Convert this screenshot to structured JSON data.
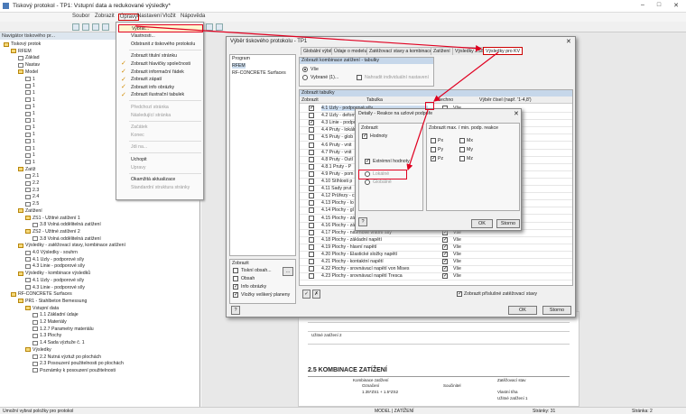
{
  "window": {
    "title": "Tiskový protokol - TP1: Vstupní data a redukované výsledky*"
  },
  "menu": [
    "Soubor",
    "Zobrazit",
    "Úpravy",
    "Nastavení",
    "Vložit",
    "Nápověda"
  ],
  "navigator": {
    "title": "Navigátor tiskového pr...",
    "items": [
      {
        "t": "Tiskový protok",
        "i": 0,
        "k": "f"
      },
      {
        "t": "RFEM",
        "i": 1,
        "k": "f"
      },
      {
        "t": "Základ",
        "i": 2,
        "k": "d"
      },
      {
        "t": "Nastav",
        "i": 2,
        "k": "d"
      },
      {
        "t": "Model",
        "i": 2,
        "k": "f"
      },
      {
        "t": "1",
        "i": 3,
        "k": "d"
      },
      {
        "t": "1",
        "i": 3,
        "k": "d"
      },
      {
        "t": "1",
        "i": 3,
        "k": "d"
      },
      {
        "t": "1",
        "i": 3,
        "k": "d"
      },
      {
        "t": "1",
        "i": 3,
        "k": "d"
      },
      {
        "t": "1",
        "i": 3,
        "k": "d"
      },
      {
        "t": "1",
        "i": 3,
        "k": "d"
      },
      {
        "t": "1",
        "i": 3,
        "k": "d"
      },
      {
        "t": "1",
        "i": 3,
        "k": "d"
      },
      {
        "t": "1",
        "i": 3,
        "k": "d"
      },
      {
        "t": "1",
        "i": 3,
        "k": "d"
      },
      {
        "t": "1",
        "i": 3,
        "k": "d"
      },
      {
        "t": "1",
        "i": 3,
        "k": "d"
      },
      {
        "t": "Zatíž",
        "i": 2,
        "k": "f"
      },
      {
        "t": "2.1",
        "i": 3,
        "k": "d"
      },
      {
        "t": "2.2",
        "i": 3,
        "k": "d"
      },
      {
        "t": "2.3",
        "i": 3,
        "k": "d"
      },
      {
        "t": "2.4",
        "i": 3,
        "k": "d"
      },
      {
        "t": "2.5",
        "i": 3,
        "k": "d"
      },
      {
        "t": "Zatížení",
        "i": 2,
        "k": "f"
      },
      {
        "t": "ZS1 - Užitné zatížení 1",
        "i": 3,
        "k": "f"
      },
      {
        "t": "3.8 Volná oddělitelná zatížení",
        "i": 4,
        "k": "d"
      },
      {
        "t": "ZS2 - Užitné zatížení 2",
        "i": 3,
        "k": "f"
      },
      {
        "t": "3.8 Volná oddělitelná zatížení",
        "i": 4,
        "k": "d"
      },
      {
        "t": "Výsledky - zatěžovací stavy, kombinace zatížení",
        "i": 2,
        "k": "f"
      },
      {
        "t": "4.0 Výsledky - souhrn",
        "i": 3,
        "k": "d"
      },
      {
        "t": "4.1 Uzly - podporové síly",
        "i": 3,
        "k": "d"
      },
      {
        "t": "4.3 Linie - podporové síly",
        "i": 3,
        "k": "d"
      },
      {
        "t": "Výsledky - kombinace výsledků",
        "i": 2,
        "k": "f"
      },
      {
        "t": "4.1 Uzly - podporové síly",
        "i": 3,
        "k": "d"
      },
      {
        "t": "4.3 Linie - podporové síly",
        "i": 3,
        "k": "d"
      },
      {
        "t": "RF-CONCRETE Surfaces",
        "i": 1,
        "k": "f"
      },
      {
        "t": "PR1 - Stahlbeton Bemessung",
        "i": 2,
        "k": "f"
      },
      {
        "t": "Vstupní data",
        "i": 3,
        "k": "f"
      },
      {
        "t": "1.1 Základní údaje",
        "i": 4,
        "k": "d"
      },
      {
        "t": "1.2 Materiály",
        "i": 4,
        "k": "d"
      },
      {
        "t": "1.2.7 Parametry materiálu",
        "i": 4,
        "k": "d"
      },
      {
        "t": "1.3 Plochy",
        "i": 4,
        "k": "d"
      },
      {
        "t": "1.4 Sada výztuže č. 1",
        "i": 4,
        "k": "d"
      },
      {
        "t": "Výsledky",
        "i": 3,
        "k": "f"
      },
      {
        "t": "2.2 Nutná výztuž po plochách",
        "i": 4,
        "k": "d"
      },
      {
        "t": "2.3 Posouzení použitelnosti po plochách",
        "i": 4,
        "k": "d"
      },
      {
        "t": "Poznámky k posouzení použitelnosti",
        "i": 4,
        "k": "d"
      }
    ]
  },
  "dropdown": [
    {
      "t": "Vybrat...",
      "hl": true
    },
    {
      "t": "Vlastnosti..."
    },
    {
      "t": "Odstranit z tiskového protokolu"
    },
    {
      "sep": true
    },
    {
      "t": "Zobrazit titulní stránku"
    },
    {
      "t": "Zobrazit hlavičky společnosti",
      "c": true
    },
    {
      "t": "Zobrazit informační řádek",
      "c": true
    },
    {
      "t": "Zobrazit zápatí",
      "c": true
    },
    {
      "t": "Zobrazit info obrázky",
      "c": true
    },
    {
      "t": "Zobrazit ilustrační tabulek",
      "c": true
    },
    {
      "sep": true
    },
    {
      "t": "Předchozí stránka",
      "d": true
    },
    {
      "t": "Následující stránka",
      "d": true
    },
    {
      "sep": true
    },
    {
      "t": "Začátek",
      "d": true
    },
    {
      "t": "Konec",
      "d": true
    },
    {
      "sep": true
    },
    {
      "t": "Jdi na...",
      "d": true
    },
    {
      "sep": true
    },
    {
      "t": "Uchopit"
    },
    {
      "t": "Upravy",
      "d": true
    },
    {
      "sep": true
    },
    {
      "t": "Okamžitá aktualizace"
    },
    {
      "t": "Standardní struktura stránky",
      "d": true
    }
  ],
  "dialog": {
    "title": "Výběr tiskového protokolu - TP1",
    "tabs": [
      "Globální výběr",
      "Údaje o modelu",
      "Zatěžovací stavy a kombinace",
      "Zatížení",
      "Výsledky ZS/KZ",
      "Výsledky pro KV"
    ],
    "program_title": "Program",
    "programs": [
      "RFEM",
      "RF-CONCRETE Surfaces"
    ],
    "comb_title": "Zobrazit kombinace zatížení - tabulky",
    "all": "Vše",
    "selected": "Vybrané (1)...",
    "individual": "Nahradit individuální nastavení",
    "tables_title": "Zobrazit tabulky",
    "col_show": "Zobrazit",
    "col_table": "Tabulka",
    "col_all": "Všechno",
    "col_sel": "Výběr čísel (např. '1-4,8')",
    "rows": [
      {
        "t": "4.1 Uzly - podporové síly",
        "c": true,
        "a": false,
        "s": "Vše",
        "hl": true
      },
      {
        "t": "4.2 Uzly - deformace",
        "c": false,
        "a": true,
        "s": "Vše"
      },
      {
        "t": "4.3 Linie - podporové síly",
        "c": true,
        "a": true,
        "s": "Vše"
      },
      {
        "t": "4.4 Pruty - lokální deformace",
        "c": false,
        "a": true,
        "s": "Vše"
      },
      {
        "t": "4.5 Pruty - glob",
        "c": false,
        "a": true,
        "s": "Vše"
      },
      {
        "t": "4.6 Pruty - vnit",
        "c": false,
        "a": true,
        "s": "Vše"
      },
      {
        "t": "4.7 Pruty - vnit",
        "c": false,
        "a": true,
        "s": "Vše"
      },
      {
        "t": "4.8 Pruty - Outl",
        "c": false,
        "a": true,
        "s": "Vše"
      },
      {
        "t": "4.8.1 Pruty - P",
        "c": false,
        "a": true,
        "s": "Vše"
      },
      {
        "t": "4.9 Pruty - pom",
        "c": false,
        "a": true,
        "s": "Vše"
      },
      {
        "t": "4.10 Štíhlosti p",
        "c": false,
        "a": true,
        "s": "Vše"
      },
      {
        "t": "4.11 Sady prut",
        "c": false,
        "a": true,
        "s": "Vše"
      },
      {
        "t": "4.12 Průřezy - c",
        "c": false,
        "a": true,
        "s": "Vše"
      },
      {
        "t": "4.13 Plochy - lo",
        "c": false,
        "a": true,
        "s": "Vše"
      },
      {
        "t": "4.14 Plochy - gl",
        "c": false,
        "a": true,
        "s": "Vše"
      },
      {
        "t": "4.15 Plochy - zá",
        "c": false,
        "a": true,
        "s": "Vše"
      },
      {
        "t": "4.16 Plochy - zá",
        "c": false,
        "a": true,
        "s": "Vše"
      },
      {
        "t": "4.17 Plochy - návrhové vnitřní síly",
        "c": false,
        "a": true,
        "s": "Vše"
      },
      {
        "t": "4.18 Plochy - základní napětí",
        "c": false,
        "a": true,
        "s": "Vše"
      },
      {
        "t": "4.19 Plochy - hlavní napětí",
        "c": false,
        "a": true,
        "s": "Vše"
      },
      {
        "t": "4.20 Plochy - Elastické složky napětí",
        "c": false,
        "a": true,
        "s": "Vše"
      },
      {
        "t": "4.21 Plochy - kontaktní napětí",
        "c": false,
        "a": true,
        "s": "Vše"
      },
      {
        "t": "4.22 Plochy - srovnávací napětí von Mises",
        "c": false,
        "a": true,
        "s": "Vše"
      },
      {
        "t": "4.23 Plochy - srovnávací napětí Tresca",
        "c": false,
        "a": true,
        "s": "Vše"
      }
    ],
    "show_title": "Zobrazit",
    "show_items": [
      {
        "t": "Tiskní obsah..."
      },
      {
        "t": "Obsah"
      },
      {
        "t": "Info obrázky",
        "c": true
      },
      {
        "t": "Vložky veškerý planeny",
        "c": true
      }
    ],
    "show_reactions": "Zobrazit příslušné zatěžovací stavy",
    "ok": "OK",
    "cancel": "Storno"
  },
  "sub": {
    "title": "Detaily - Reakce na uzlové podpoře",
    "zobrazit": "Zobrazit",
    "hodnoty": "Hodnoty",
    "extremni": "Extrémní hodnoty",
    "lokalne": "Lokálně",
    "globalne": "Globálně",
    "minmax_title": "Zobrazit max. / min. podp. reakce",
    "pcol": [
      "Px",
      "Py",
      "Pz"
    ],
    "mcol": [
      "Mx",
      "My",
      "Mz"
    ],
    "ok": "OK",
    "cancel": "Storno"
  },
  "report": {
    "heading": "2.5 KOMBINACE ZATÍŽENÍ",
    "lines": [
      "Kombinace zatížení",
      "Označení",
      "Součinitel",
      "Zatěžovací stav",
      "Užitné zatížení 2",
      "Vlastní tíha",
      "Užitné zatížení 1",
      "1.35*ZS1 + 1.5*ZS2"
    ]
  },
  "status": {
    "left": "Umožní vybrat položky pro protokol",
    "center": "MODEL | ZATÍŽENÍ",
    "pages": "Stránky: 31",
    "page": "Stránka: 2"
  }
}
